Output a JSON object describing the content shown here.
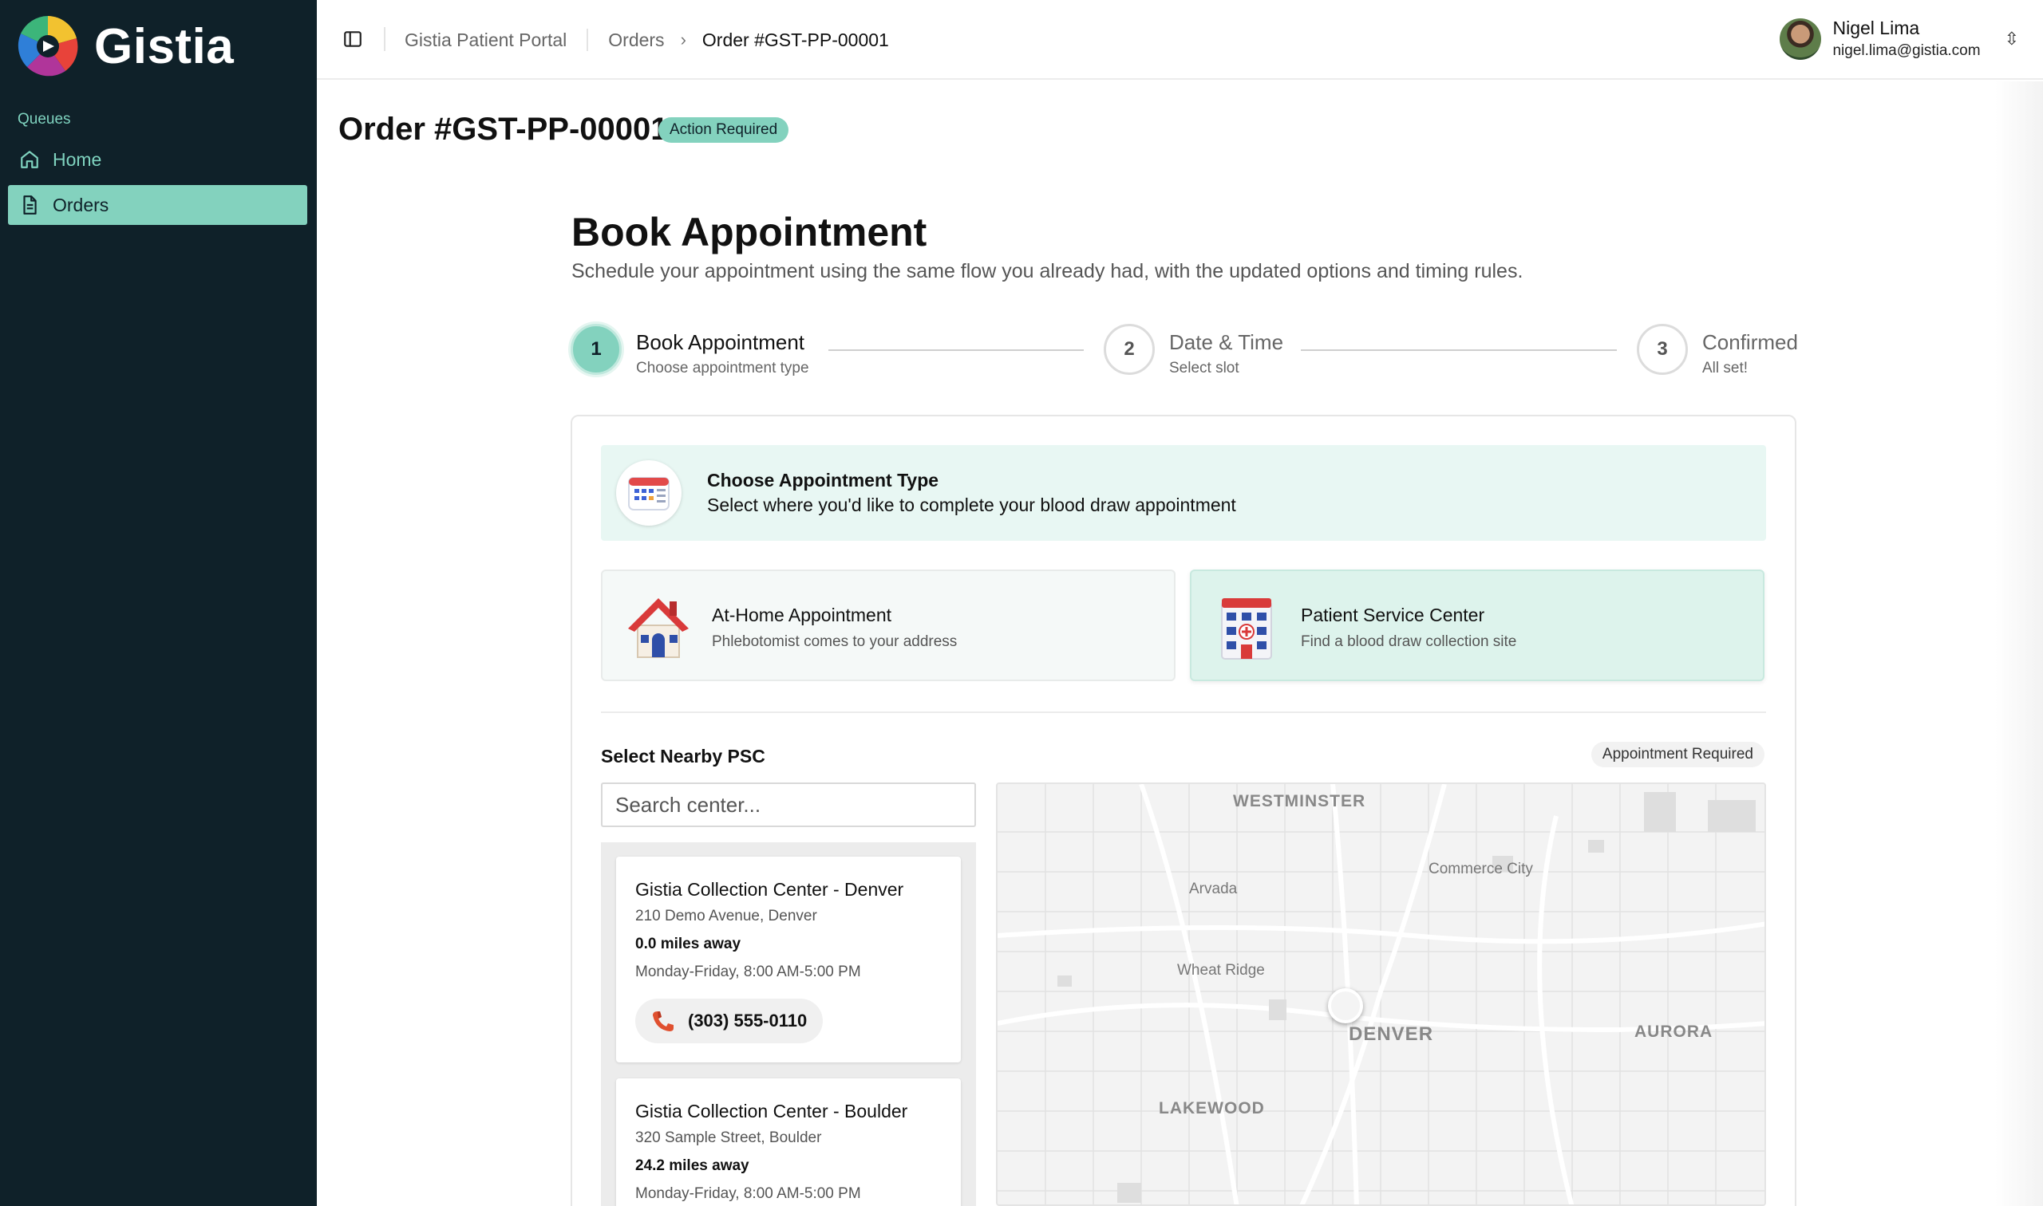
{
  "app": {
    "logo_text": "Gistia",
    "brand_color": "#83d2be",
    "sidebar_color": "#0f2129"
  },
  "sidebar": {
    "section_label": "Queues",
    "items": [
      {
        "label": "Home",
        "icon": "home-icon",
        "active": false
      },
      {
        "label": "Orders",
        "icon": "document-icon",
        "active": true
      }
    ]
  },
  "header": {
    "breadcrumb": [
      "Gistia Patient Portal",
      "Orders",
      "Order #GST-PP-00001"
    ],
    "user": {
      "name": "Nigel Lima",
      "email": "nigel.lima@gistia.com"
    }
  },
  "page": {
    "title": "Order #GST-PP-00001",
    "status_badge": "Action Required"
  },
  "booking": {
    "title": "Book Appointment",
    "subtitle": "Schedule your appointment using the same flow you already had, with the updated options and timing rules.",
    "steps": [
      {
        "number": "1",
        "title": "Book Appointment",
        "desc": "Choose appointment type",
        "active": true
      },
      {
        "number": "2",
        "title": "Date & Time",
        "desc": "Select slot",
        "active": false
      },
      {
        "number": "3",
        "title": "Confirmed",
        "desc": "All set!",
        "active": false
      }
    ],
    "type_banner": {
      "title": "Choose Appointment Type",
      "desc": "Select where you'd like to complete your blood draw appointment"
    },
    "options": [
      {
        "title": "At-Home Appointment",
        "desc": "Phlebotomist comes to your address",
        "icon": "house-icon",
        "selected": false
      },
      {
        "title": "Patient Service Center",
        "desc": "Find a blood draw collection site",
        "icon": "hospital-building-icon",
        "selected": true
      }
    ],
    "psc": {
      "heading": "Select Nearby PSC",
      "badge": "Appointment Required",
      "search_placeholder": "Search center...",
      "centers": [
        {
          "name": "Gistia Collection Center - Denver",
          "address": "210 Demo Avenue, Denver",
          "distance": "0.0 miles away",
          "hours": "Monday-Friday, 8:00 AM-5:00 PM",
          "phone": "(303) 555-0110"
        },
        {
          "name": "Gistia Collection Center - Boulder",
          "address": "320 Sample Street, Boulder",
          "distance": "24.2 miles away",
          "hours": "Monday-Friday, 8:00 AM-5:00 PM"
        }
      ]
    },
    "map": {
      "labels": [
        "WESTMINSTER",
        "Commerce City",
        "Arvada",
        "Wheat Ridge",
        "DENVER",
        "AURORA",
        "LAKEWOOD"
      ]
    }
  }
}
